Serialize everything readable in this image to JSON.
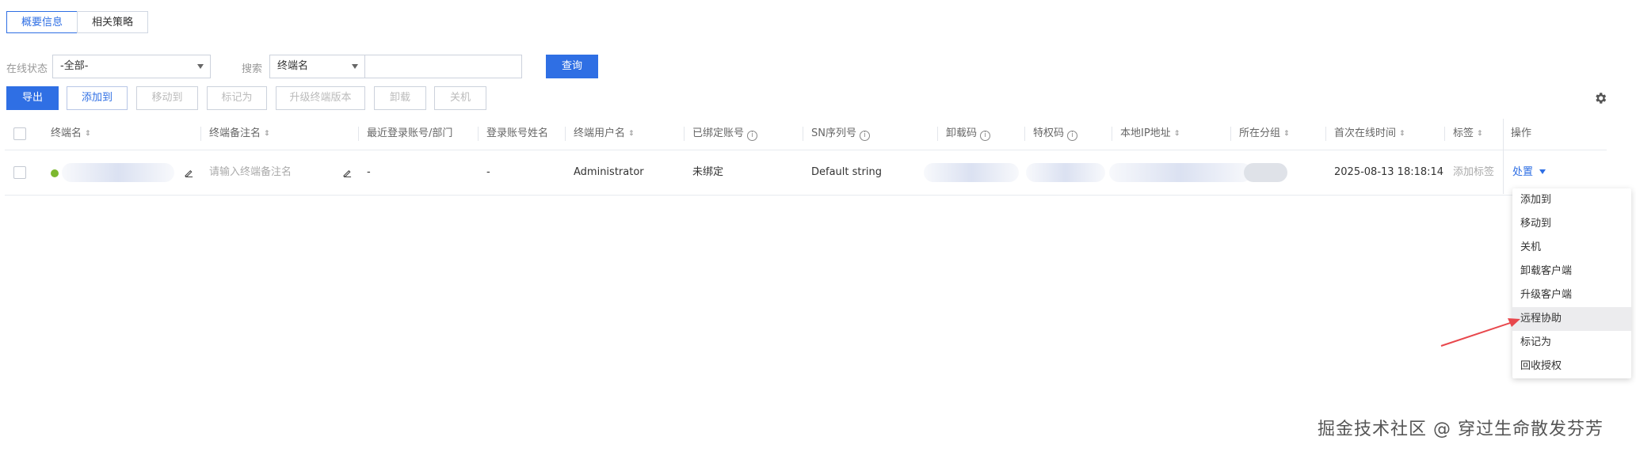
{
  "tabs": [
    {
      "label": "概要信息",
      "active": true
    },
    {
      "label": "相关策略",
      "active": false
    }
  ],
  "filters": {
    "status_label": "在线状态",
    "status_value": "-全部-",
    "search_label": "搜索",
    "search_field_value": "终端名",
    "search_input_value": "",
    "query_button": "查询"
  },
  "toolbar": {
    "export": "导出",
    "add_to": "添加到",
    "move_to": "移动到",
    "mark_as": "标记为",
    "upgrade": "升级终端版本",
    "uninstall": "卸载",
    "shutdown": "关机",
    "settings_icon": "gear-icon"
  },
  "table": {
    "headers": {
      "terminal_name": "终端名",
      "remark_name": "终端备注名",
      "recent_login": "最近登录账号/部门",
      "login_name": "登录账号姓名",
      "terminal_user": "终端用户名",
      "bound_account": "已绑定账号",
      "sn": "SN序列号",
      "uninstall_code": "卸载码",
      "privilege_code": "特权码",
      "local_ip": "本地IP地址",
      "group": "所在分组",
      "first_online": "首次在线时间",
      "tag": "标签",
      "actions": "操作"
    },
    "row": {
      "remark_placeholder": "请输入终端备注名",
      "recent_login": "-",
      "login_name": "-",
      "terminal_user": "Administrator",
      "bound_account": "未绑定",
      "sn": "Default string",
      "first_online": "2025-08-13 18:18:14",
      "tag": "添加标签",
      "action": "处置",
      "online_color": "#7cb82f"
    }
  },
  "action_menu": {
    "items": [
      "添加到",
      "移动到",
      "关机",
      "卸载客户端",
      "升级客户端",
      "远程协助",
      "标记为",
      "回收授权"
    ],
    "hovered_index": 5
  },
  "watermark": "掘金技术社区 @ 穿过生命散发芬芳"
}
